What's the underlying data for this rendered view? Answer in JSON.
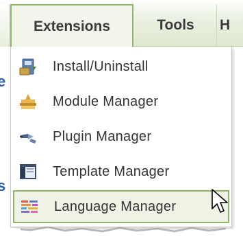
{
  "menubar": {
    "extensions_label": "Extensions",
    "tools_label": "Tools",
    "help_label": "H"
  },
  "background": {
    "frag1": "e",
    "frag2": "s"
  },
  "dropdown": {
    "items": [
      {
        "label": "Install/Uninstall",
        "icon": "install-icon"
      },
      {
        "label": "Module Manager",
        "icon": "module-icon"
      },
      {
        "label": "Plugin Manager",
        "icon": "plugin-icon"
      },
      {
        "label": "Template Manager",
        "icon": "template-icon"
      },
      {
        "label": "Language Manager",
        "icon": "language-icon"
      }
    ],
    "highlighted_item": "Language Manager"
  },
  "colors": {
    "accent_border": "#8fb46a",
    "menubar_bg": "#dfe8cf",
    "text": "#333333"
  }
}
